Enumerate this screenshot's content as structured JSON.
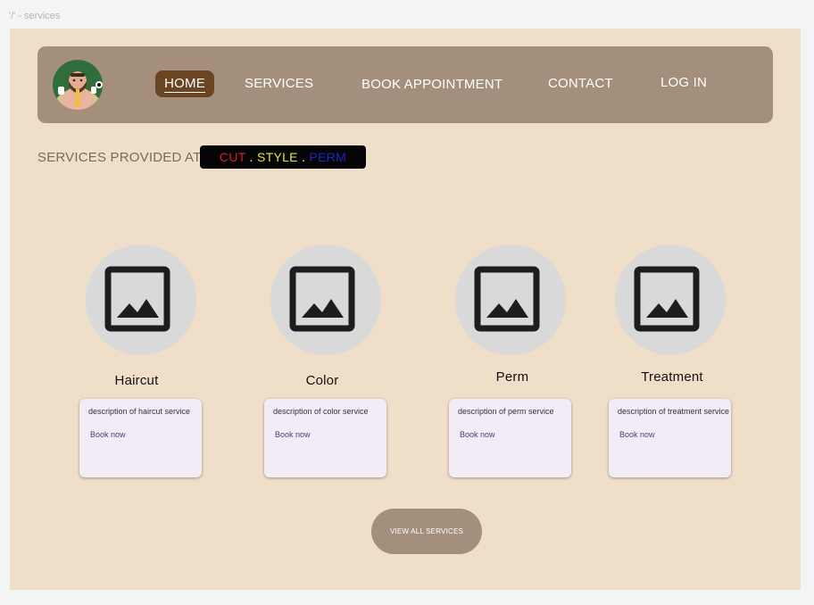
{
  "frame": {
    "label": "'/' - services"
  },
  "nav": {
    "items": [
      {
        "label": "HOME",
        "active": true
      },
      {
        "label": "SERVICES"
      },
      {
        "label": "BOOK APPOINTMENT"
      },
      {
        "label": "CONTACT"
      },
      {
        "label": "LOG IN"
      }
    ]
  },
  "heading": {
    "text": "SERVICES PROVIDED AT",
    "brand": {
      "cut": "CUT",
      "style": "STYLE",
      "perm": "PERM",
      "dot": "."
    }
  },
  "services": [
    {
      "name": "Haircut",
      "description": "description of haircut service",
      "action": "Book now"
    },
    {
      "name": "Color",
      "description": "description of color service",
      "action": "Book now"
    },
    {
      "name": "Perm",
      "description": "description of perm service",
      "action": "Book now"
    },
    {
      "name": "Treatment",
      "description": "description of treatment service",
      "action": "Book now"
    }
  ],
  "view_all": {
    "label": "VIEW ALL SERVICES"
  },
  "colors": {
    "background": "#f0dfc8",
    "navbar": "#a38f7c",
    "active_nav": "#6b4423",
    "brand_cut": "#e01e1e",
    "brand_style": "#e6e633",
    "brand_perm": "#2323c8",
    "card": "#f1ecf6"
  },
  "icons": [
    "avatar-image",
    "image-placeholder-icon"
  ]
}
